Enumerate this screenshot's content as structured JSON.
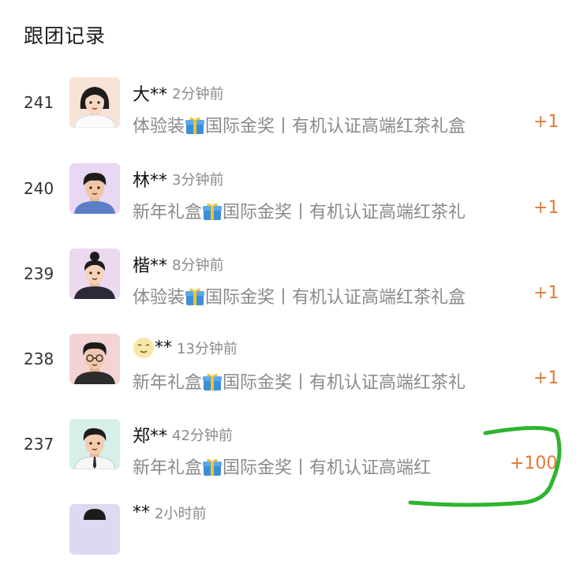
{
  "section_title": "跟团记录",
  "records": [
    {
      "index": "241",
      "nickname": "大**",
      "time": "2分钟前",
      "product": "体验装",
      "detail": "国际金奖丨有机认证高端红茶礼盒",
      "qty": "+1"
    },
    {
      "index": "240",
      "nickname": "林**",
      "time": "3分钟前",
      "product": "新年礼盒",
      "detail": "国际金奖丨有机认证高端红茶礼",
      "qty": "+1"
    },
    {
      "index": "239",
      "nickname": "楷**",
      "time": "8分钟前",
      "product": "体验装",
      "detail": "国际金奖丨有机认证高端红茶礼盒",
      "qty": "+1"
    },
    {
      "index": "238",
      "nickname": "**",
      "time": "13分钟前",
      "product": "新年礼盒",
      "detail": "国际金奖丨有机认证高端红茶礼",
      "qty": "+1"
    },
    {
      "index": "237",
      "nickname": "郑**",
      "time": "42分钟前",
      "product": "新年礼盒",
      "detail": "国际金奖丨有机认证高端红",
      "qty": "+100"
    },
    {
      "index": "",
      "nickname": "**",
      "time": "2小时前",
      "product": "",
      "detail": "",
      "qty": ""
    }
  ],
  "colors": {
    "qty": "#e07a3a",
    "annotation": "#2db52d",
    "muted": "#8a8a8a"
  },
  "icons": [
    "gift-icon",
    "smile-emoji-icon",
    "avatar-icon"
  ]
}
